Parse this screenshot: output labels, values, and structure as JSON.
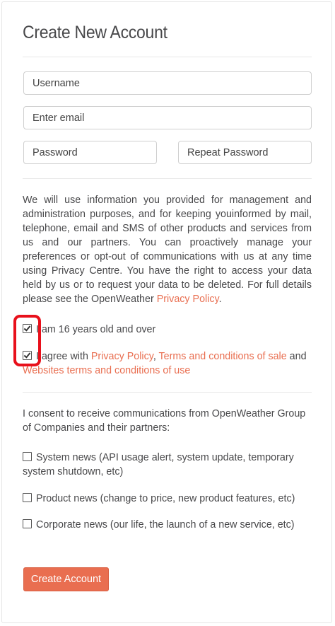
{
  "form": {
    "title": "Create New Account",
    "username_placeholder": "Username",
    "email_placeholder": "Enter email",
    "password_placeholder": "Password",
    "repeat_password_placeholder": "Repeat Password"
  },
  "info": {
    "text": "We will use information you provided for management and administration purposes, and for keeping youinformed by mail, telephone, email and SMS of other products and services from us and our partners. You can proactively manage your preferences or opt-out of communications with us at any time using Privacy Centre. You have the right to access your data held by us or to request your data to be deleted. For full details please see the OpenWeather ",
    "privacy_link": "Privacy Policy",
    "end": "."
  },
  "agreements": {
    "age": {
      "checked": true,
      "label": "I am 16 years old and over"
    },
    "terms": {
      "checked": true,
      "prefix": "I agree with ",
      "privacy_link": "Privacy Policy",
      "sep": ", ",
      "terms_link": "Terms and conditions of sale",
      "and": " and ",
      "website_link": "Websites terms and conditions of use"
    }
  },
  "consent": {
    "text": "I consent to receive communications from OpenWeather Group of Companies and their partners:",
    "options": [
      {
        "checked": false,
        "label": "System news (API usage alert, system update, temporary system shutdown, etc)"
      },
      {
        "checked": false,
        "label": "Product news (change to price, new product features, etc)"
      },
      {
        "checked": false,
        "label": "Corporate news (our life, the launch of a new service, etc)"
      }
    ]
  },
  "submit_label": "Create Account",
  "colors": {
    "accent": "#e96e50",
    "highlight": "#e8101b"
  }
}
